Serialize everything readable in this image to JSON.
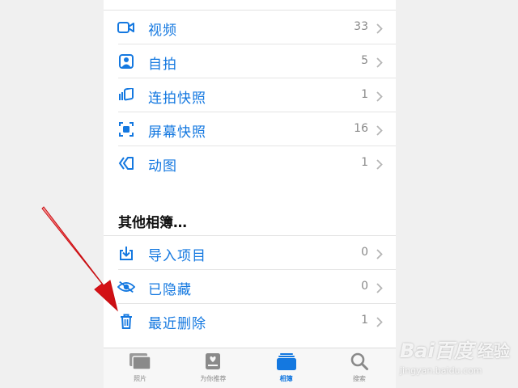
{
  "colors": {
    "accent": "#1478e0",
    "arrow": "#e8141a",
    "muted": "#8a8a8a"
  },
  "media_types": {
    "items": [
      {
        "label": "视频",
        "count": "33",
        "icon": "video-icon"
      },
      {
        "label": "自拍",
        "count": "5",
        "icon": "selfie-icon"
      },
      {
        "label": "连拍快照",
        "count": "1",
        "icon": "burst-icon"
      },
      {
        "label": "屏幕快照",
        "count": "16",
        "icon": "screenshot-icon"
      },
      {
        "label": "动图",
        "count": "1",
        "icon": "animated-icon"
      }
    ]
  },
  "other_albums": {
    "title": "其他相簿…",
    "items": [
      {
        "label": "导入项目",
        "count": "0",
        "icon": "import-icon"
      },
      {
        "label": "已隐藏",
        "count": "0",
        "icon": "hidden-eye-icon"
      },
      {
        "label": "最近删除",
        "count": "1",
        "icon": "trash-icon"
      }
    ]
  },
  "tabbar": {
    "tabs": [
      {
        "label": "照片",
        "icon": "photos-icon",
        "active": false
      },
      {
        "label": "为你推荐",
        "icon": "for-you-icon",
        "active": false
      },
      {
        "label": "相簿",
        "icon": "albums-icon",
        "active": true
      },
      {
        "label": "搜索",
        "icon": "search-icon",
        "active": false
      }
    ]
  },
  "watermark": {
    "logo": "Bai百度",
    "sub": "经验",
    "url": "jingyan.baidu.com"
  }
}
